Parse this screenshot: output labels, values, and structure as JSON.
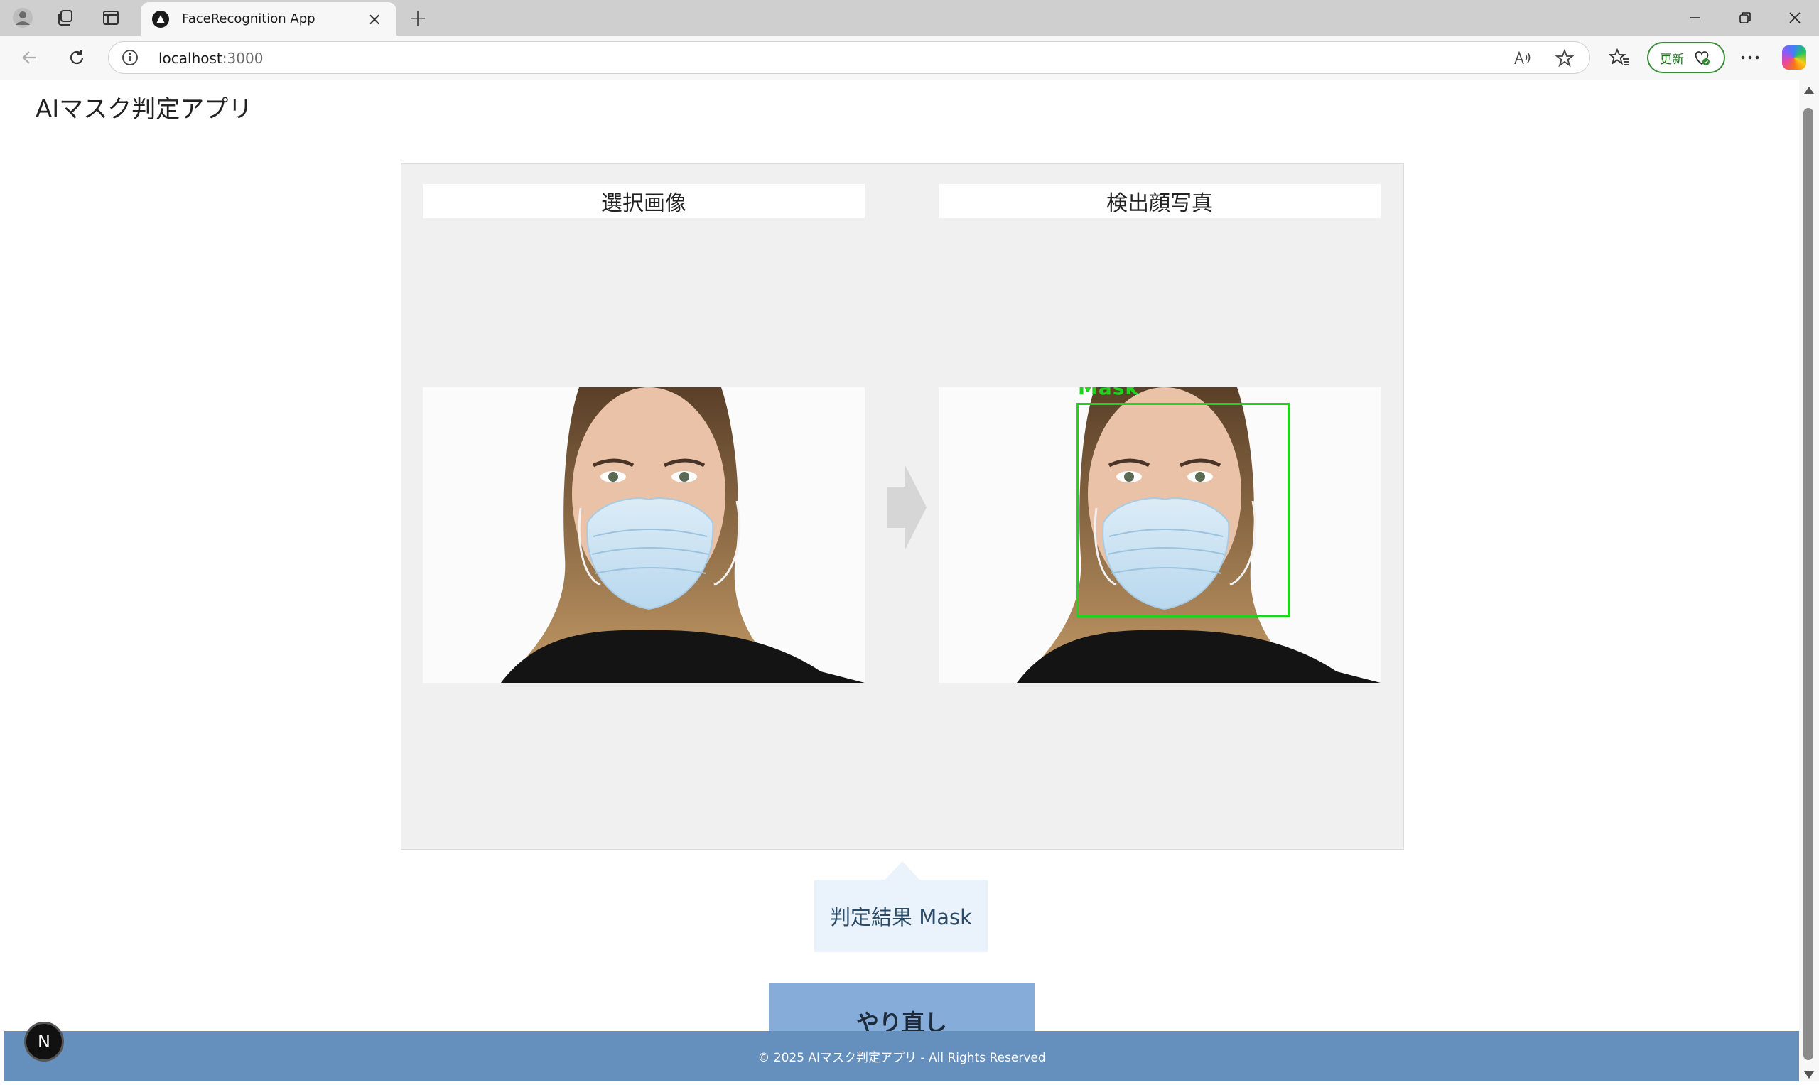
{
  "browser": {
    "tab_title": "FaceRecognition App",
    "tab_close": "×",
    "new_tab": "+",
    "url_host": "localhost",
    "url_port": ":3000",
    "update_label": "更新"
  },
  "page": {
    "app_title": "AIマスク判定アプリ",
    "selected_image_label": "選択画像",
    "detected_face_label": "検出顔写真",
    "detection_label": "Mask",
    "result_text": "判定結果 Mask",
    "retry_label": "やり直し",
    "footer_text": "© 2025 AIマスク判定アプリ - All Rights Reserved",
    "dev_badge": "N"
  },
  "colors": {
    "detection_box": "#1ed41e",
    "footer_bg": "#6590bd",
    "retry_bg": "#86acd9",
    "result_bg": "#eaf2fb",
    "panel_bg": "#f0f0f0"
  },
  "icons": [
    "profile-icon",
    "workspaces-icon",
    "vertical-tabs-icon",
    "back-icon",
    "reload-icon",
    "info-icon",
    "read-aloud-icon",
    "favorite-star-icon",
    "favorites-icon",
    "more-icon",
    "copilot-icon",
    "minimize-icon",
    "restore-icon",
    "close-window-icon",
    "arrow-right-icon"
  ]
}
